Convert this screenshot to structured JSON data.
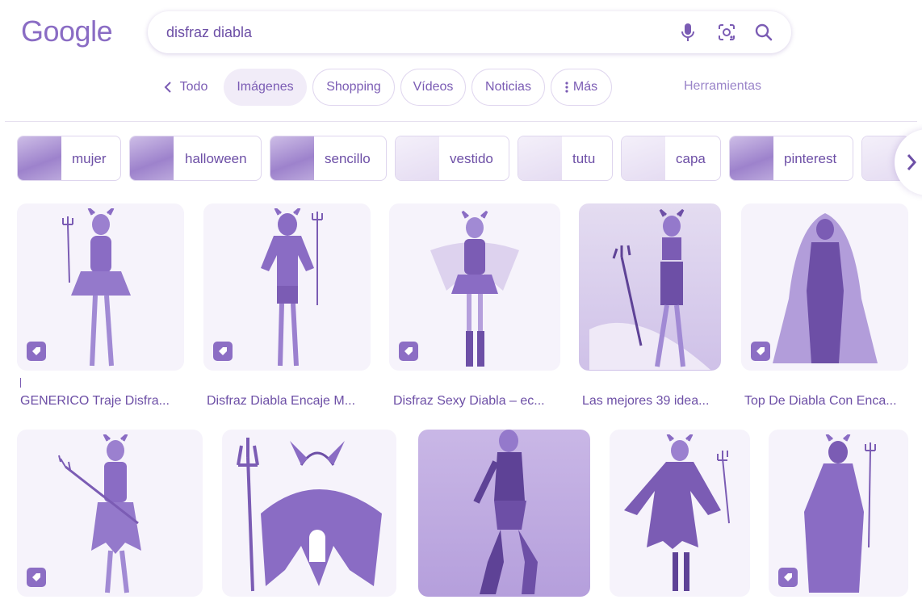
{
  "logo": "Google",
  "search": {
    "query": "disfraz diabla"
  },
  "tabs": [
    {
      "label": "Todo"
    },
    {
      "label": "Imágenes"
    },
    {
      "label": "Shopping"
    },
    {
      "label": "Vídeos"
    },
    {
      "label": "Noticias"
    },
    {
      "label": "Más"
    }
  ],
  "tools": "Herramientas",
  "chips": [
    {
      "label": "mujer"
    },
    {
      "label": "halloween"
    },
    {
      "label": "sencillo"
    },
    {
      "label": "vestido"
    },
    {
      "label": "tutu"
    },
    {
      "label": "capa"
    },
    {
      "label": "pinterest"
    }
  ],
  "results_row1": [
    {
      "caption": "GENERICO Traje Disfra..."
    },
    {
      "caption": "Disfraz Diabla Encaje M..."
    },
    {
      "caption": "Disfraz Sexy Diabla – ec..."
    },
    {
      "caption": "Las mejores 39 idea..."
    },
    {
      "caption": "Top De Diabla Con Enca..."
    }
  ],
  "colors": {
    "accent": "#7b5cb4",
    "tint": "#f1ecf8",
    "badge": "#8c6ec4"
  },
  "icons": [
    "microphone-icon",
    "google-lens-icon",
    "search-icon",
    "back-chevron-icon",
    "more-dots-icon",
    "chevron-right-icon",
    "product-tag-icon"
  ]
}
